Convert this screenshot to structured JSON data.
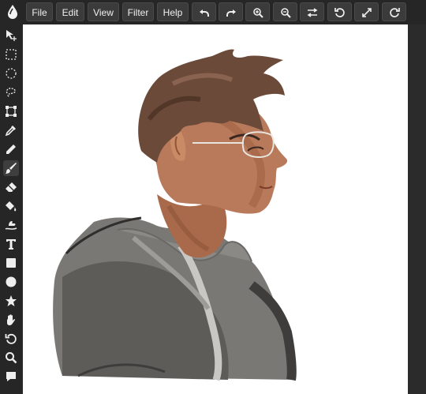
{
  "menu": {
    "file_label": "File",
    "edit_label": "Edit",
    "view_label": "View",
    "filter_label": "Filter",
    "help_label": "Help"
  },
  "toolbar_buttons": [
    "undo-icon",
    "redo-icon",
    "zoom-in-icon",
    "zoom-out-icon",
    "swap-icon",
    "rotate-ccw-icon",
    "fullscreen-icon",
    "rotate-cw-icon"
  ],
  "tools": [
    "move-icon",
    "rect-select-icon",
    "ellipse-select-icon",
    "lasso-icon",
    "transform-icon",
    "eyedropper-icon",
    "pencil-icon",
    "brush-icon",
    "eraser-icon",
    "bucket-fill-icon",
    "smudge-icon",
    "text-icon",
    "rectangle-icon",
    "ellipse-icon",
    "star-icon",
    "hand-icon",
    "rotate-icon",
    "zoom-icon",
    "comment-icon"
  ],
  "active_tool": "brush-icon",
  "colors": {
    "chrome": "#262626",
    "button_bg": "#3b3b3b",
    "canvas_bg": "#ffffff"
  }
}
